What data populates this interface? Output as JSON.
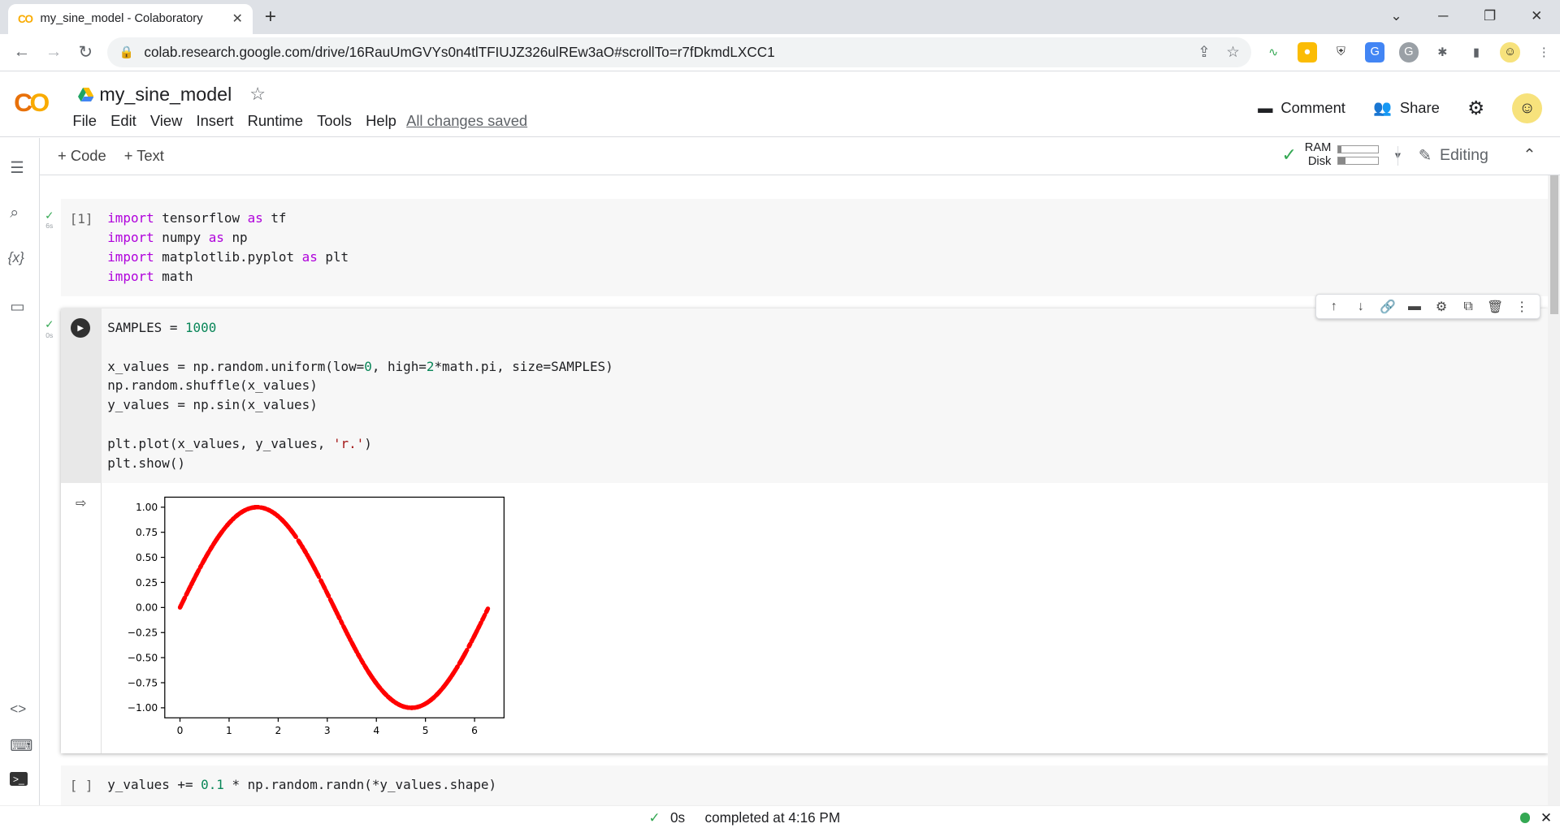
{
  "browser": {
    "tab_title": "my_sine_model - Colaboratory",
    "favicon": "CO",
    "url": "colab.research.google.com/drive/16RauUmGVYs0n4tlTFIUJZ326ulREw3aO#scrollTo=r7fDkmdLXCC1"
  },
  "header": {
    "logo": "CO",
    "title": "my_sine_model",
    "menu": [
      "File",
      "Edit",
      "View",
      "Insert",
      "Runtime",
      "Tools",
      "Help"
    ],
    "saved_status": "All changes saved",
    "comment_label": "Comment",
    "share_label": "Share"
  },
  "toolbar": {
    "add_code": "+ Code",
    "add_text": "+ Text",
    "ram_label": "RAM",
    "disk_label": "Disk",
    "ram_fraction": 0.08,
    "disk_fraction": 0.18,
    "mode": "Editing"
  },
  "cells": [
    {
      "exec_count": "[1]",
      "status_check": "✓",
      "status_time": "6s",
      "lines": [
        [
          {
            "t": "import",
            "c": "k"
          },
          {
            "t": " tensorflow "
          },
          {
            "t": "as",
            "c": "k"
          },
          {
            "t": " tf"
          }
        ],
        [
          {
            "t": "import",
            "c": "k"
          },
          {
            "t": " numpy "
          },
          {
            "t": "as",
            "c": "k"
          },
          {
            "t": " np"
          }
        ],
        [
          {
            "t": "import",
            "c": "k"
          },
          {
            "t": " matplotlib.pyplot "
          },
          {
            "t": "as",
            "c": "k"
          },
          {
            "t": " plt"
          }
        ],
        [
          {
            "t": "import",
            "c": "k"
          },
          {
            "t": " math"
          }
        ]
      ]
    },
    {
      "exec_count": "",
      "status_check": "✓",
      "status_time": "0s",
      "lines": [
        [
          {
            "t": "SAMPLES = "
          },
          {
            "t": "1000",
            "c": "n"
          }
        ],
        [],
        [
          {
            "t": "x_values = np.random.uniform(low="
          },
          {
            "t": "0",
            "c": "n"
          },
          {
            "t": ", high="
          },
          {
            "t": "2",
            "c": "n"
          },
          {
            "t": "*math.pi, size=SAMPLES)"
          }
        ],
        [
          {
            "t": "np.random.shuffle(x_values)"
          }
        ],
        [
          {
            "t": "y_values = np.sin(x_values)"
          }
        ],
        [],
        [
          {
            "t": "plt.plot(x_values, y_values, "
          },
          {
            "t": "'r.'",
            "c": "s"
          },
          {
            "t": ")"
          }
        ],
        [
          {
            "t": "plt.show()"
          }
        ]
      ]
    },
    {
      "exec_count": "[ ]",
      "lines": [
        [
          {
            "t": "y_values += "
          },
          {
            "t": "0.1",
            "c": "n"
          },
          {
            "t": " * np.random.randn(*y_values.shape)"
          }
        ]
      ]
    }
  ],
  "chart_data": {
    "type": "scatter",
    "marker_color": "#ff0000",
    "function": "sin(x)",
    "x_range": [
      0,
      6.2832
    ],
    "sample_count": 1000,
    "xlim": [
      -0.31,
      6.6
    ],
    "ylim": [
      -1.1,
      1.1
    ],
    "x_ticks": [
      0,
      1,
      2,
      3,
      4,
      5,
      6
    ],
    "y_ticks": [
      "1.00",
      "0.75",
      "0.50",
      "0.25",
      "0.00",
      "−0.25",
      "−0.50",
      "−0.75",
      "−1.00"
    ],
    "y_tick_values": [
      1,
      0.75,
      0.5,
      0.25,
      0,
      -0.25,
      -0.5,
      -0.75,
      -1
    ],
    "title": "",
    "xlabel": "",
    "ylabel": ""
  },
  "status_bar": {
    "time": "0s",
    "message": "completed at 4:16 PM"
  }
}
